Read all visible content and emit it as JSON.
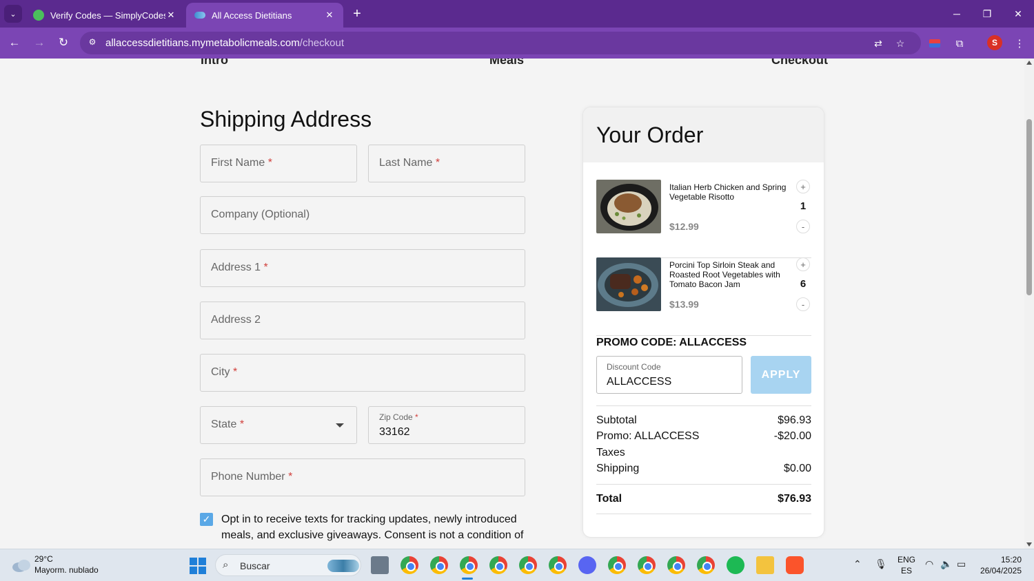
{
  "browser": {
    "tabs": [
      {
        "title": "Verify Codes — SimplyCodes",
        "active": false
      },
      {
        "title": "All Access Dietitians",
        "active": true
      }
    ],
    "url_host": "allaccessdietitians.mymetabolicmeals.com",
    "url_path": "/checkout",
    "profile_initial": "S"
  },
  "steps": [
    "Intro",
    "Meals",
    "Checkout"
  ],
  "shipping": {
    "title": "Shipping Address",
    "first_name": "First Name",
    "last_name": "Last Name",
    "company": "Company (Optional)",
    "address1": "Address 1",
    "address2": "Address 2",
    "city": "City",
    "state": "State",
    "zip_label": "Zip Code",
    "zip_value": "33162",
    "phone": "Phone Number",
    "required_mark": "*",
    "optin_checked": true,
    "optin_text": "Opt in to receive texts for tracking updates, newly introduced meals, and exclusive giveaways. Consent is not a condition of"
  },
  "order": {
    "title": "Your Order",
    "items": [
      {
        "name": "Italian Herb Chicken and Spring Vegetable Risotto",
        "price": "$12.99",
        "qty": "1"
      },
      {
        "name": "Porcini Top Sirloin Steak and Roasted Root Vegetables with Tomato Bacon Jam",
        "price": "$13.99",
        "qty": "6"
      }
    ],
    "plus": "+",
    "minus": "-",
    "promo_title": "PROMO CODE: ALLACCESS",
    "discount_label": "Discount Code",
    "discount_value": "ALLACCESS",
    "apply_label": "APPLY",
    "subtotal_label": "Subtotal",
    "subtotal": "$96.93",
    "promo_label": "Promo: ALLACCESS",
    "promo_amount": "-$20.00",
    "taxes_label": "Taxes",
    "shipping_label": "Shipping",
    "shipping_amount": "$0.00",
    "total_label": "Total",
    "total": "$76.93"
  },
  "taskbar": {
    "temp": "29°C",
    "weather": "Mayorm. nublado",
    "search": "Buscar",
    "lang1": "ENG",
    "lang2": "ES",
    "time": "15:20",
    "date": "26/04/2025"
  },
  "colors": {
    "browser_frame": "#5b2a8f",
    "toolbar": "#7b45b4",
    "apply_button": "#a8d4f1",
    "checkbox": "#5aa8e6",
    "required": "#d1403c"
  }
}
